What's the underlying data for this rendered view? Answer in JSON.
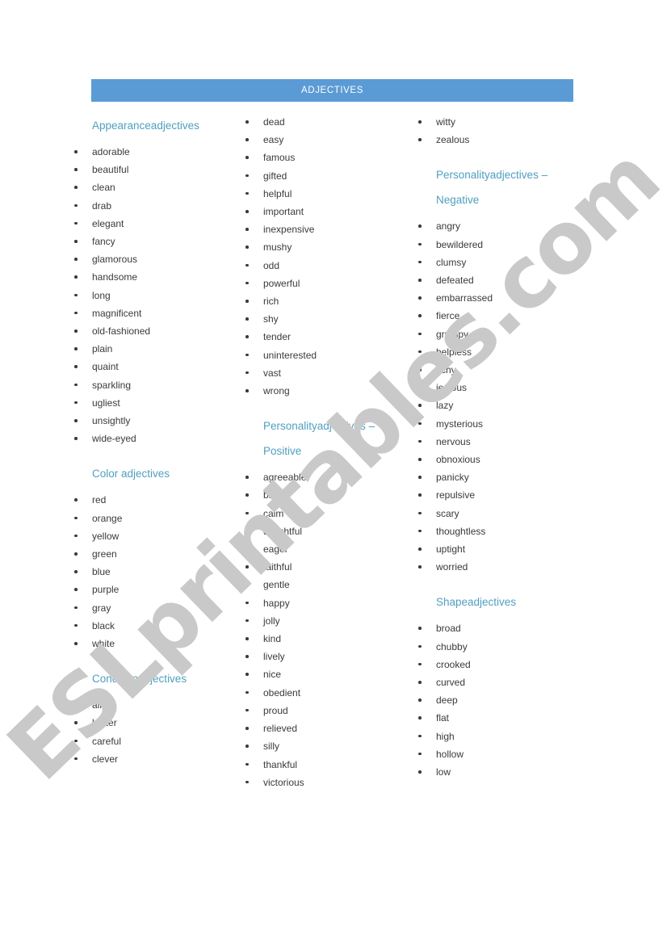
{
  "document": {
    "title_bar": {
      "label": "ADJECTIVES"
    },
    "watermark": "ESLprintables.com",
    "colors": {
      "title_bar_bg": "#5b9bd5",
      "title_bar_text": "#ffffff",
      "heading": "#4f9fc0",
      "body_text": "#3a3a3a",
      "watermark": "#c9c9c9",
      "page_bg": "#ffffff"
    }
  },
  "columns": [
    {
      "id": "column-1",
      "sections": [
        {
          "heading": "Appearanceadjectives",
          "items": [
            "adorable",
            "beautiful",
            "clean",
            "drab",
            "elegant",
            "fancy",
            "glamorous",
            "handsome",
            "long",
            "magnificent",
            "old-fashioned",
            "plain",
            "quaint",
            "sparkling",
            "ugliest",
            "unsightly",
            "wide-eyed"
          ]
        },
        {
          "heading": "Color adjectives",
          "items": [
            "red",
            "orange",
            "yellow",
            "green",
            "blue",
            "purple",
            "gray",
            "black",
            "white"
          ]
        },
        {
          "heading": "Conditionadjectives",
          "items": [
            "alive",
            "better",
            "careful",
            "clever"
          ]
        }
      ]
    },
    {
      "id": "column-2",
      "sections": [
        {
          "heading": "",
          "items": [
            "dead",
            "easy",
            "famous",
            "gifted",
            "helpful",
            "important",
            "inexpensive",
            "mushy",
            "odd",
            "powerful",
            "rich",
            "shy",
            "tender",
            "uninterested",
            "vast",
            "wrong"
          ]
        },
        {
          "heading": "Personalityadjectives – Positive",
          "items": [
            "agreeable",
            "brave",
            "calm",
            "delightful",
            "eager",
            "faithful",
            "gentle",
            "happy",
            "jolly",
            "kind",
            "lively",
            "nice",
            "obedient",
            "proud",
            "relieved",
            "silly",
            "thankful",
            "victorious"
          ]
        }
      ]
    },
    {
      "id": "column-3",
      "sections": [
        {
          "heading": "",
          "items": [
            "witty",
            "zealous"
          ]
        },
        {
          "heading": "Personalityadjectives – Negative",
          "items": [
            "angry",
            "bewildered",
            "clumsy",
            "defeated",
            "embarrassed",
            "fierce",
            "grumpy",
            "helpless",
            "itchy",
            "jealous",
            "lazy",
            "mysterious",
            "nervous",
            "obnoxious",
            "panicky",
            "repulsive",
            "scary",
            "thoughtless",
            "uptight",
            "worried"
          ]
        },
        {
          "heading": "Shapeadjectives",
          "items": [
            "broad",
            "chubby",
            "crooked",
            "curved",
            "deep",
            "flat",
            "high",
            "hollow",
            "low"
          ]
        }
      ]
    }
  ]
}
